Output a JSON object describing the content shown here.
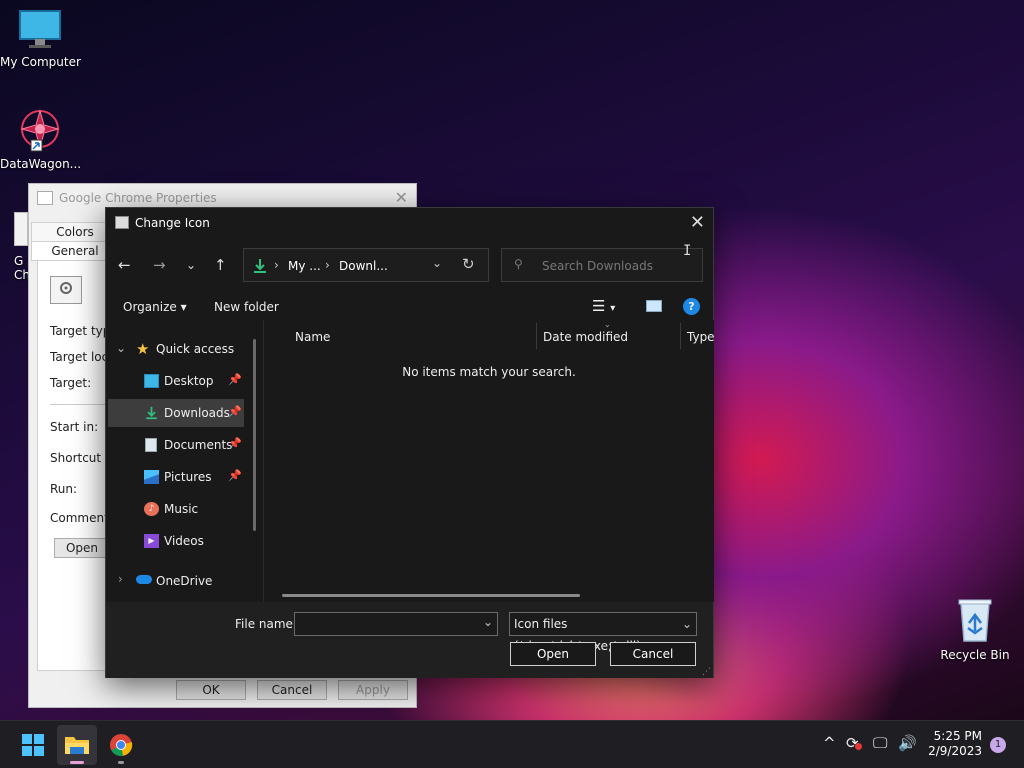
{
  "desktop": {
    "icons": [
      {
        "name": "my-computer",
        "label": "My Computer"
      },
      {
        "name": "datawagon",
        "label": "DataWagon..."
      },
      {
        "name": "recycle-bin",
        "label": "Recycle Bin"
      },
      {
        "name": "google-chrome-shortcut",
        "label": "G\nCh"
      }
    ]
  },
  "properties_window": {
    "title": "Google Chrome Properties",
    "tabs": [
      "Colors",
      "General"
    ],
    "fields": [
      "Target typ",
      "Target loc",
      "Target:",
      "Start in:",
      "Shortcut k",
      "Run:",
      "Comment:"
    ],
    "open_button": "Open",
    "ok": "OK",
    "cancel": "Cancel",
    "apply": "Apply"
  },
  "dialog": {
    "title": "Change Icon",
    "breadcrumb": [
      "My ...",
      "Downl..."
    ],
    "search_placeholder": "Search Downloads",
    "organize": "Organize",
    "new_folder": "New folder",
    "nav": [
      {
        "label": "Quick access"
      },
      {
        "label": "Desktop",
        "pinned": true
      },
      {
        "label": "Downloads",
        "pinned": true,
        "selected": true
      },
      {
        "label": "Documents",
        "pinned": true
      },
      {
        "label": "Pictures",
        "pinned": true
      },
      {
        "label": "Music"
      },
      {
        "label": "Videos"
      },
      {
        "label": "OneDrive"
      }
    ],
    "columns": [
      "Name",
      "Date modified",
      "Type"
    ],
    "empty_message": "No items match your search.",
    "file_name_label": "File name:",
    "file_name_value": "",
    "file_type": "Icon files (*.ico;*.icl;*.exe;*.dll)",
    "open_button": "Open",
    "cancel_button": "Cancel"
  },
  "taskbar": {
    "time": "5:25 PM",
    "date": "2/9/2023",
    "notification_count": "1"
  },
  "colors": {
    "dialog_bg": "#191919",
    "accent_blue": "#1e88e5",
    "download_green": "#2ec27e",
    "star_yellow": "#f5c542"
  }
}
